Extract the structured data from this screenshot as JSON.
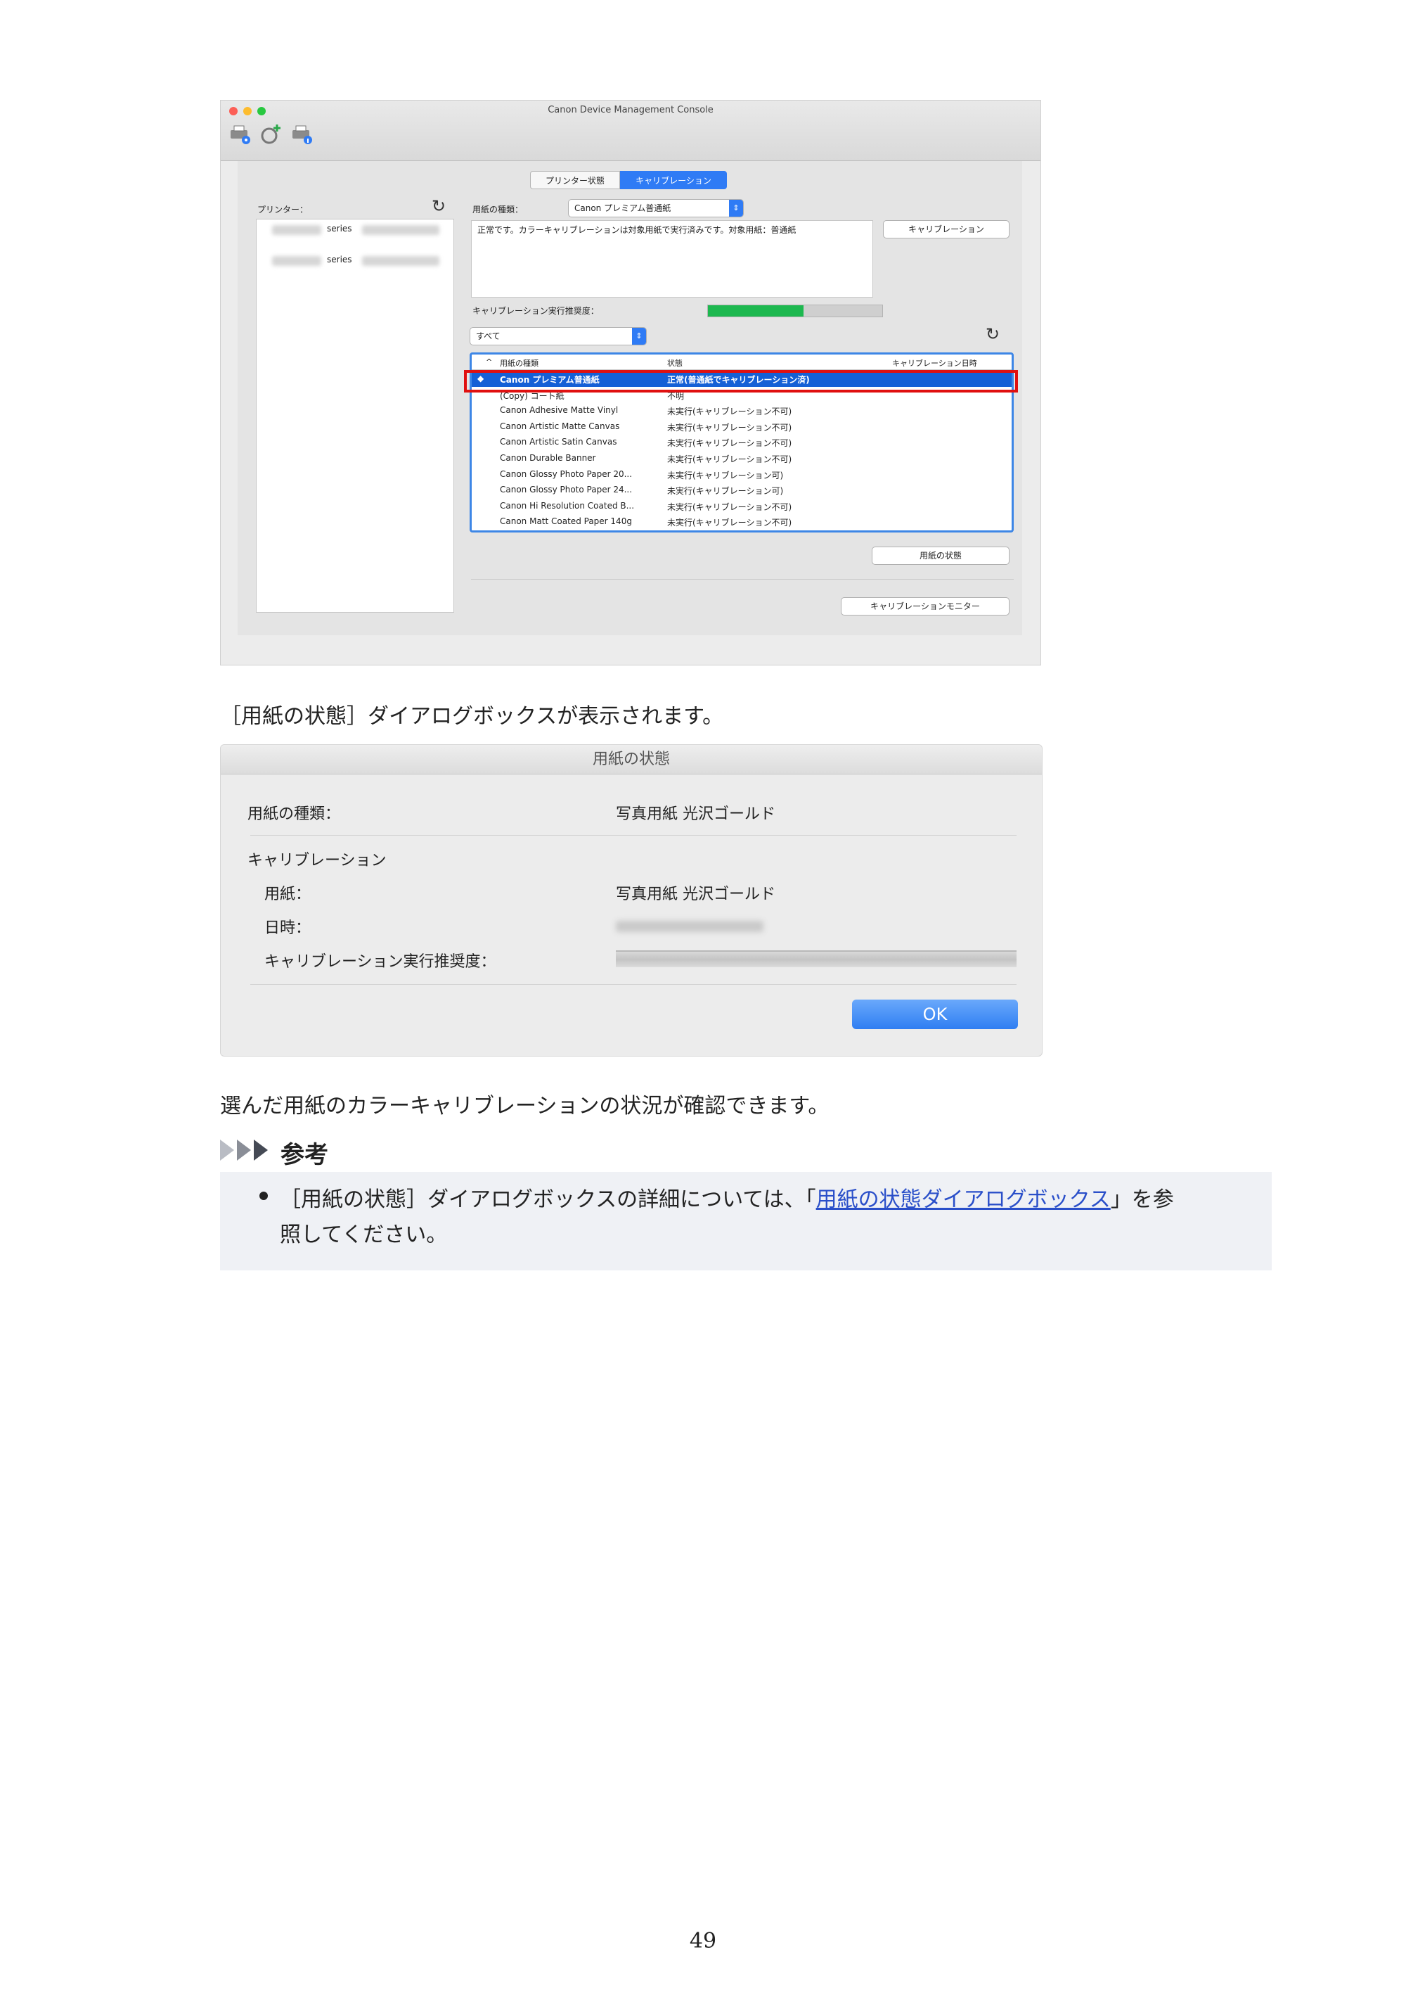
{
  "console": {
    "window_title": "Canon Device Management Console",
    "tabs": [
      "プリンター状態",
      "キャリブレーション"
    ],
    "printer_label": "プリンター：",
    "printers": [
      {
        "name": "series"
      },
      {
        "name": "series"
      }
    ],
    "paper_type_label": "用紙の種類：",
    "paper_type_value": "Canon プレミアム普通紙",
    "status_message": "正常です。カラーキャリブレーションは対象用紙で実行済みです。対象用紙：普通紙",
    "calibration_button": "キャリブレーション",
    "recommend_label": "キャリブレーション実行推奨度：",
    "recommend_level": 0.55,
    "filter_value": "すべて",
    "table_headers": [
      "用紙の種類",
      "状態",
      "キャリブレーション日時"
    ],
    "rows": [
      {
        "name": "Canon プレミアム普通紙",
        "status": "正常(普通紙でキャリブレーション済)",
        "selected": true
      },
      {
        "name": "(Copy) コート紙",
        "status": "不明"
      },
      {
        "name": "Canon Adhesive Matte Vinyl",
        "status": "未実行(キャリブレーション不可)"
      },
      {
        "name": "Canon Artistic Matte Canvas",
        "status": "未実行(キャリブレーション不可)"
      },
      {
        "name": "Canon Artistic Satin Canvas",
        "status": "未実行(キャリブレーション不可)"
      },
      {
        "name": "Canon Durable Banner",
        "status": "未実行(キャリブレーション不可)"
      },
      {
        "name": "Canon Glossy Photo Paper 20...",
        "status": "未実行(キャリブレーション可)"
      },
      {
        "name": "Canon Glossy Photo Paper 24...",
        "status": "未実行(キャリブレーション可)"
      },
      {
        "name": "Canon Hi Resolution Coated B...",
        "status": "未実行(キャリブレーション不可)"
      },
      {
        "name": "Canon Matt Coated Paper 140g",
        "status": "未実行(キャリブレーション不可)"
      }
    ],
    "paper_status_button": "用紙の状態",
    "monitor_button": "キャリブレーションモニター"
  },
  "caption1": "［用紙の状態］ダイアログボックスが表示されます。",
  "dialog": {
    "title": "用紙の状態",
    "paper_type_label": "用紙の種類：",
    "paper_type_value": "写真用紙 光沢ゴールド",
    "section": "キャリブレーション",
    "paper_label": "用紙：",
    "paper_value": "写真用紙 光沢ゴールド",
    "datetime_label": "日時：",
    "recommend_label": "キャリブレーション実行推奨度：",
    "ok": "OK"
  },
  "caption2": "選んだ用紙のカラーキャリブレーションの状況が確認できます。",
  "reference": {
    "title": "参考",
    "line1_before": "［用紙の状態］ダイアログボックスの詳細については、「",
    "line1_link": "用紙の状態ダイアログボックス",
    "line1_after": "」を参",
    "line2": "照してください。"
  },
  "page_number": "49",
  "colors": {
    "accent_blue": "#2f7bf5",
    "selection_blue": "#1560d6",
    "highlight_red": "#e01010",
    "progress_green": "#1db84f",
    "link": "#2a4fc9"
  }
}
